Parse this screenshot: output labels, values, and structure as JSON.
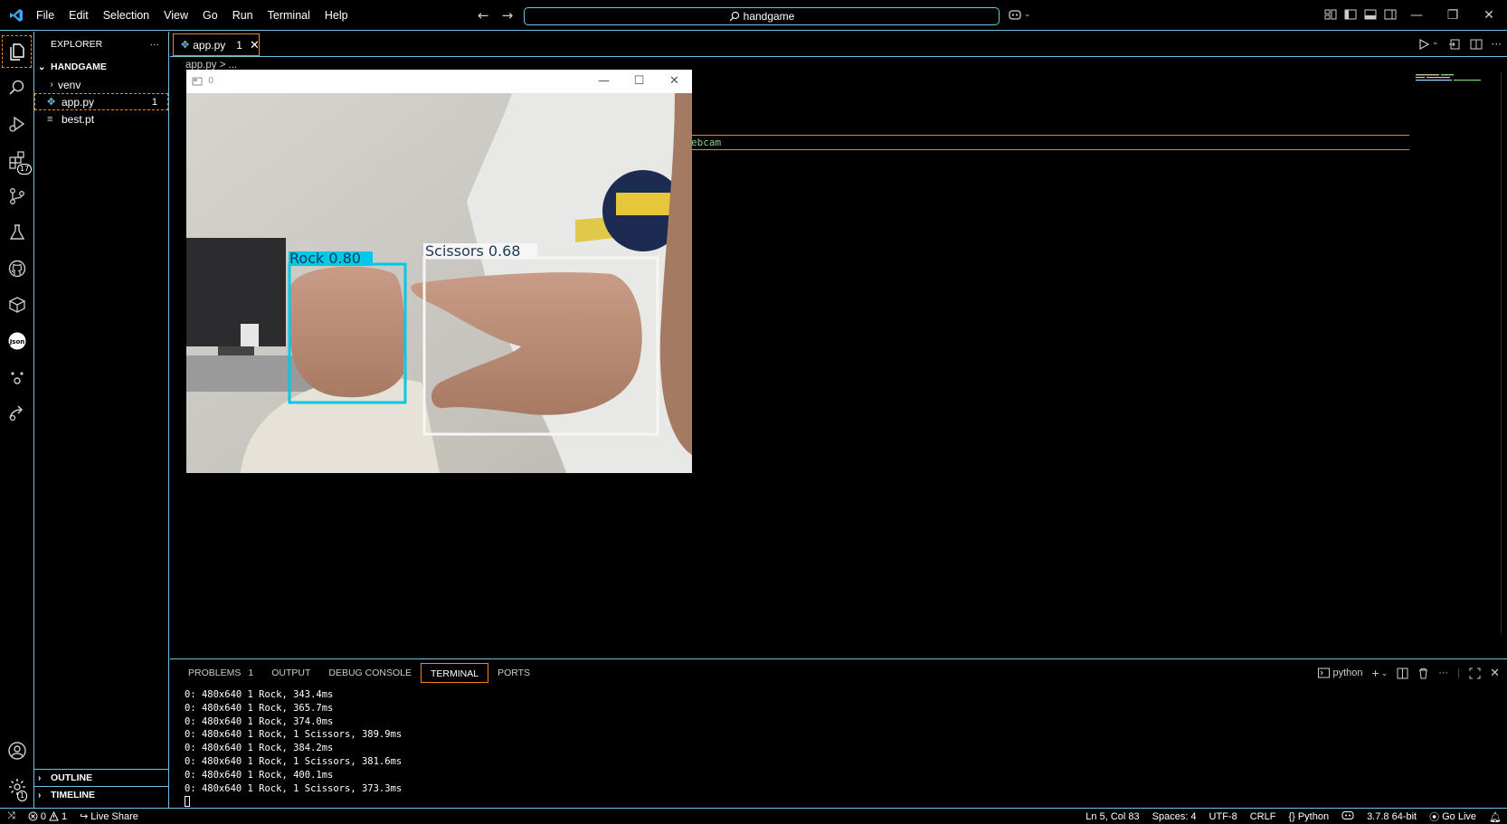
{
  "titlebar": {
    "menu": [
      "File",
      "Edit",
      "Selection",
      "View",
      "Go",
      "Run",
      "Terminal",
      "Help"
    ],
    "search_text": "handgame"
  },
  "activity": {
    "extensions_badge": "17",
    "settings_badge": "1"
  },
  "sidebar": {
    "title": "EXPLORER",
    "more": "···",
    "folder": "HANDGAME",
    "items": [
      {
        "label": "venv",
        "kind": "folder"
      },
      {
        "label": "app.py",
        "kind": "python",
        "badge": "1"
      },
      {
        "label": "best.pt",
        "kind": "file"
      }
    ],
    "outline": "OUTLINE",
    "timeline": "TIMELINE"
  },
  "editor": {
    "tab_label": "app.py",
    "tab_badge": "1",
    "breadcrumb": "app.py > ...",
    "code_fragment": "ebcam"
  },
  "camera_window": {
    "title": "0",
    "detections": [
      {
        "label": "Rock 0.80",
        "color": "#00c8e6"
      },
      {
        "label": "Scissors 0.68",
        "color": "#ffffff"
      }
    ]
  },
  "panel": {
    "tabs": [
      {
        "label": "PROBLEMS",
        "badge": "1"
      },
      {
        "label": "OUTPUT"
      },
      {
        "label": "DEBUG CONSOLE"
      },
      {
        "label": "TERMINAL",
        "active": true
      },
      {
        "label": "PORTS"
      }
    ],
    "terminal_name": "python",
    "terminal_lines": [
      "0: 480x640 1 Rock, 343.4ms",
      "0: 480x640 1 Rock, 365.7ms",
      "0: 480x640 1 Rock, 374.0ms",
      "0: 480x640 1 Rock, 1 Scissors, 389.9ms",
      "0: 480x640 1 Rock, 384.2ms",
      "0: 480x640 1 Rock, 1 Scissors, 381.6ms",
      "0: 480x640 1 Rock, 400.1ms",
      "0: 480x640 1 Rock, 1 Scissors, 373.3ms"
    ]
  },
  "statusbar": {
    "errors": "0",
    "warnings": "1",
    "live_share": "Live Share",
    "position": "Ln 5, Col 83",
    "spaces": "Spaces: 4",
    "encoding": "UTF-8",
    "eol": "CRLF",
    "language": "Python",
    "interpreter": "3.7.8 64-bit",
    "go_live": "Go Live"
  },
  "colors": {
    "border": "#6fc3df",
    "focus": "#f38518",
    "rock_box": "#00c8e6"
  }
}
